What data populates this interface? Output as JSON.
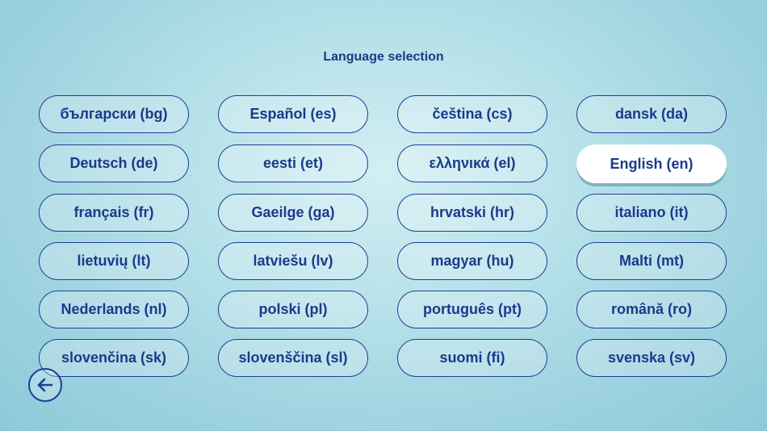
{
  "header": {
    "title": "Language selection"
  },
  "languages": [
    "български (bg)",
    "Español (es)",
    "čeština (cs)",
    "dansk (da)",
    "Deutsch (de)",
    "eesti (et)",
    "ελληνικά (el)",
    "English (en)",
    "français (fr)",
    "Gaeilge (ga)",
    "hrvatski (hr)",
    "italiano (it)",
    "lietuvių (lt)",
    "latviešu (lv)",
    "magyar (hu)",
    "Malti (mt)",
    "Nederlands (nl)",
    "polski (pl)",
    "português (pt)",
    "română (ro)",
    "slovenčina (sk)",
    "slovenščina (sl)",
    "suomi (fi)",
    "svenska (sv)"
  ],
  "selected_language": "English (en)",
  "back_button": {
    "icon": "arrow-left-icon"
  },
  "colors": {
    "accent": "#1d3e96",
    "text": "#1b3a8a",
    "selected_bg": "#ffffff"
  }
}
